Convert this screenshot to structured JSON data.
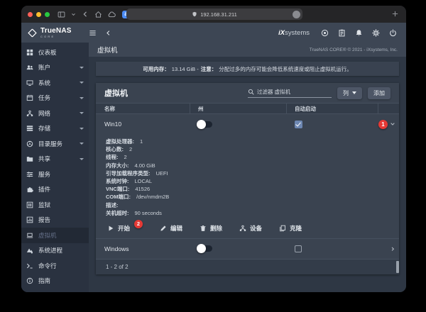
{
  "browser": {
    "url": "192.168.31.211",
    "traffic_lights": [
      "#ff5f57",
      "#febc2e",
      "#28c840"
    ],
    "nav_icons": [
      "panel-toggle",
      "chevron-down",
      "back",
      "home",
      "cloud"
    ],
    "extensions": [
      {
        "name": "extension-translate",
        "color": "#4b8bf5",
        "shape": "square",
        "kind": "letter",
        "glyph": "a"
      },
      {
        "name": "extension-globe",
        "color": "#4a69d4",
        "shape": "circle",
        "kind": "globe"
      },
      {
        "name": "extension-check",
        "color": "#4d90d9",
        "shape": "circle",
        "kind": "check"
      },
      {
        "name": "extension-ring",
        "color": "#1f6ff2",
        "shape": "circle",
        "kind": "ring"
      }
    ]
  },
  "app_header": {
    "brand": "TrueNAS",
    "brand_sub": "CORE",
    "partner_prefix": "iX",
    "partner_suffix": "systems",
    "icons": [
      "truecommand",
      "tasks",
      "notifications",
      "settings",
      "power"
    ]
  },
  "sidebar": {
    "items": [
      {
        "label": "仪表板",
        "icon": "dashboard",
        "expandable": false,
        "active": false
      },
      {
        "label": "账户",
        "icon": "accounts",
        "expandable": true,
        "active": false
      },
      {
        "label": "系统",
        "icon": "system",
        "expandable": true,
        "active": false
      },
      {
        "label": "任务",
        "icon": "tasks",
        "expandable": true,
        "active": false
      },
      {
        "label": "网络",
        "icon": "network",
        "expandable": true,
        "active": false
      },
      {
        "label": "存储",
        "icon": "storage",
        "expandable": true,
        "active": false
      },
      {
        "label": "目录服务",
        "icon": "directory",
        "expandable": true,
        "active": false
      },
      {
        "label": "共享",
        "icon": "sharing",
        "expandable": true,
        "active": false
      },
      {
        "label": "服务",
        "icon": "services",
        "expandable": false,
        "active": false
      },
      {
        "label": "插件",
        "icon": "plugins",
        "expandable": false,
        "active": false
      },
      {
        "label": "监狱",
        "icon": "jails",
        "expandable": false,
        "active": false
      },
      {
        "label": "报告",
        "icon": "reporting",
        "expandable": false,
        "active": false
      },
      {
        "label": "虚拟机",
        "icon": "vm",
        "expandable": false,
        "active": true
      },
      {
        "label": "系统进程",
        "icon": "processes",
        "expandable": false,
        "active": false
      },
      {
        "label": "命令行",
        "icon": "shell",
        "expandable": false,
        "active": false
      },
      {
        "label": "指南",
        "icon": "guide",
        "expandable": false,
        "active": false
      }
    ]
  },
  "page": {
    "breadcrumb": "虚拟机",
    "copyright": "TrueNAS CORE® © 2021 - iXsystems, Inc.",
    "notice": {
      "mem_label": "可用内存：",
      "mem_value": "13.14 GiB - ",
      "warn_label": "注意：",
      "warn_text": "分配过多的内存可能会降低系统速度或阻止虚拟机运行。"
    }
  },
  "vm_card": {
    "title": "虚拟机",
    "filter_label": "过滤器 虚拟机",
    "columns_button": "列",
    "add_button": "添加",
    "columns": [
      "名称",
      "州",
      "自动启动"
    ],
    "rows": [
      {
        "name": "Win10",
        "state": "off",
        "autostart": true,
        "badge": "1",
        "expanded": true
      },
      {
        "name": "Windows",
        "state": "off",
        "autostart": false,
        "expanded": false
      }
    ],
    "details": [
      {
        "label": "虚拟处理器:",
        "value": "1"
      },
      {
        "label": "核心数:",
        "value": "2"
      },
      {
        "label": "线程:",
        "value": "2"
      },
      {
        "label": "内存大小:",
        "value": "4.00 GiB"
      },
      {
        "label": "引导加载程序类型:",
        "value": "UEFI"
      },
      {
        "label": "系统时钟:",
        "value": "LOCAL"
      },
      {
        "label": "VNC端口:",
        "value": "41526"
      },
      {
        "label": "COM端口:",
        "value": "/dev/nmdm2B"
      },
      {
        "label": "描述:",
        "value": ""
      },
      {
        "label": "关机超时:",
        "value": "90 seconds"
      }
    ],
    "actions": [
      {
        "label": "开始",
        "icon": "play",
        "badge": "2"
      },
      {
        "label": "编辑",
        "icon": "edit",
        "badge": ""
      },
      {
        "label": "删除",
        "icon": "delete",
        "badge": ""
      },
      {
        "label": "设备",
        "icon": "devices",
        "badge": ""
      },
      {
        "label": "克隆",
        "icon": "clone",
        "badge": ""
      }
    ],
    "footer": "1 - 2 of 2"
  }
}
